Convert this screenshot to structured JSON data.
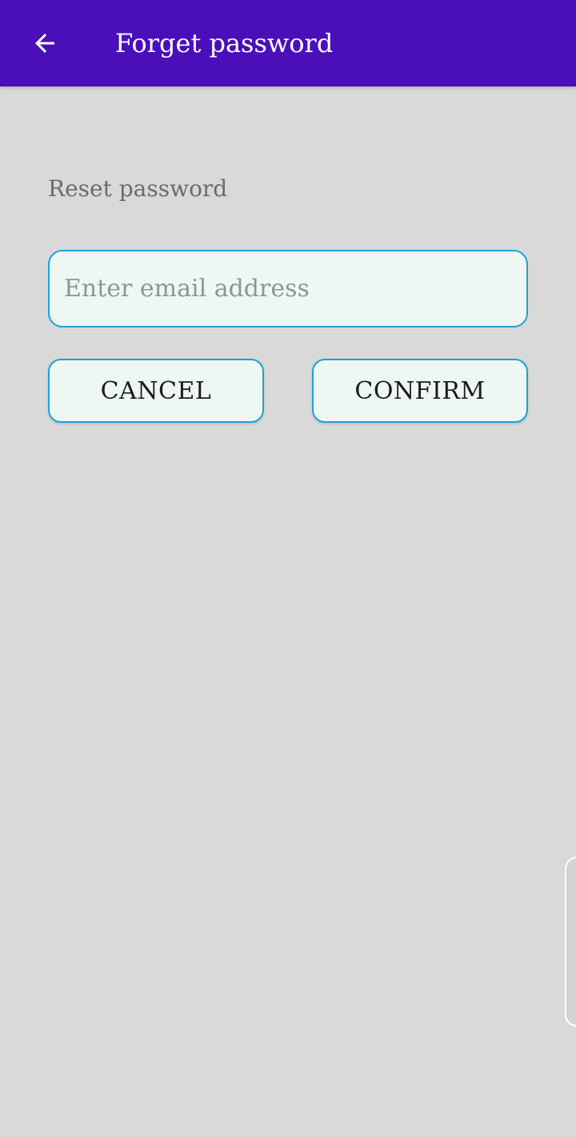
{
  "app_bar": {
    "title": "Forget password",
    "back_icon": "arrow-left-icon",
    "background_color": "#4b0fb9"
  },
  "form": {
    "section_label": "Reset password",
    "email_field": {
      "value": "",
      "placeholder": "Enter email address"
    },
    "cancel_label": "CANCEL",
    "confirm_label": "CONFIRM",
    "accent_color": "#1ea0d8"
  }
}
